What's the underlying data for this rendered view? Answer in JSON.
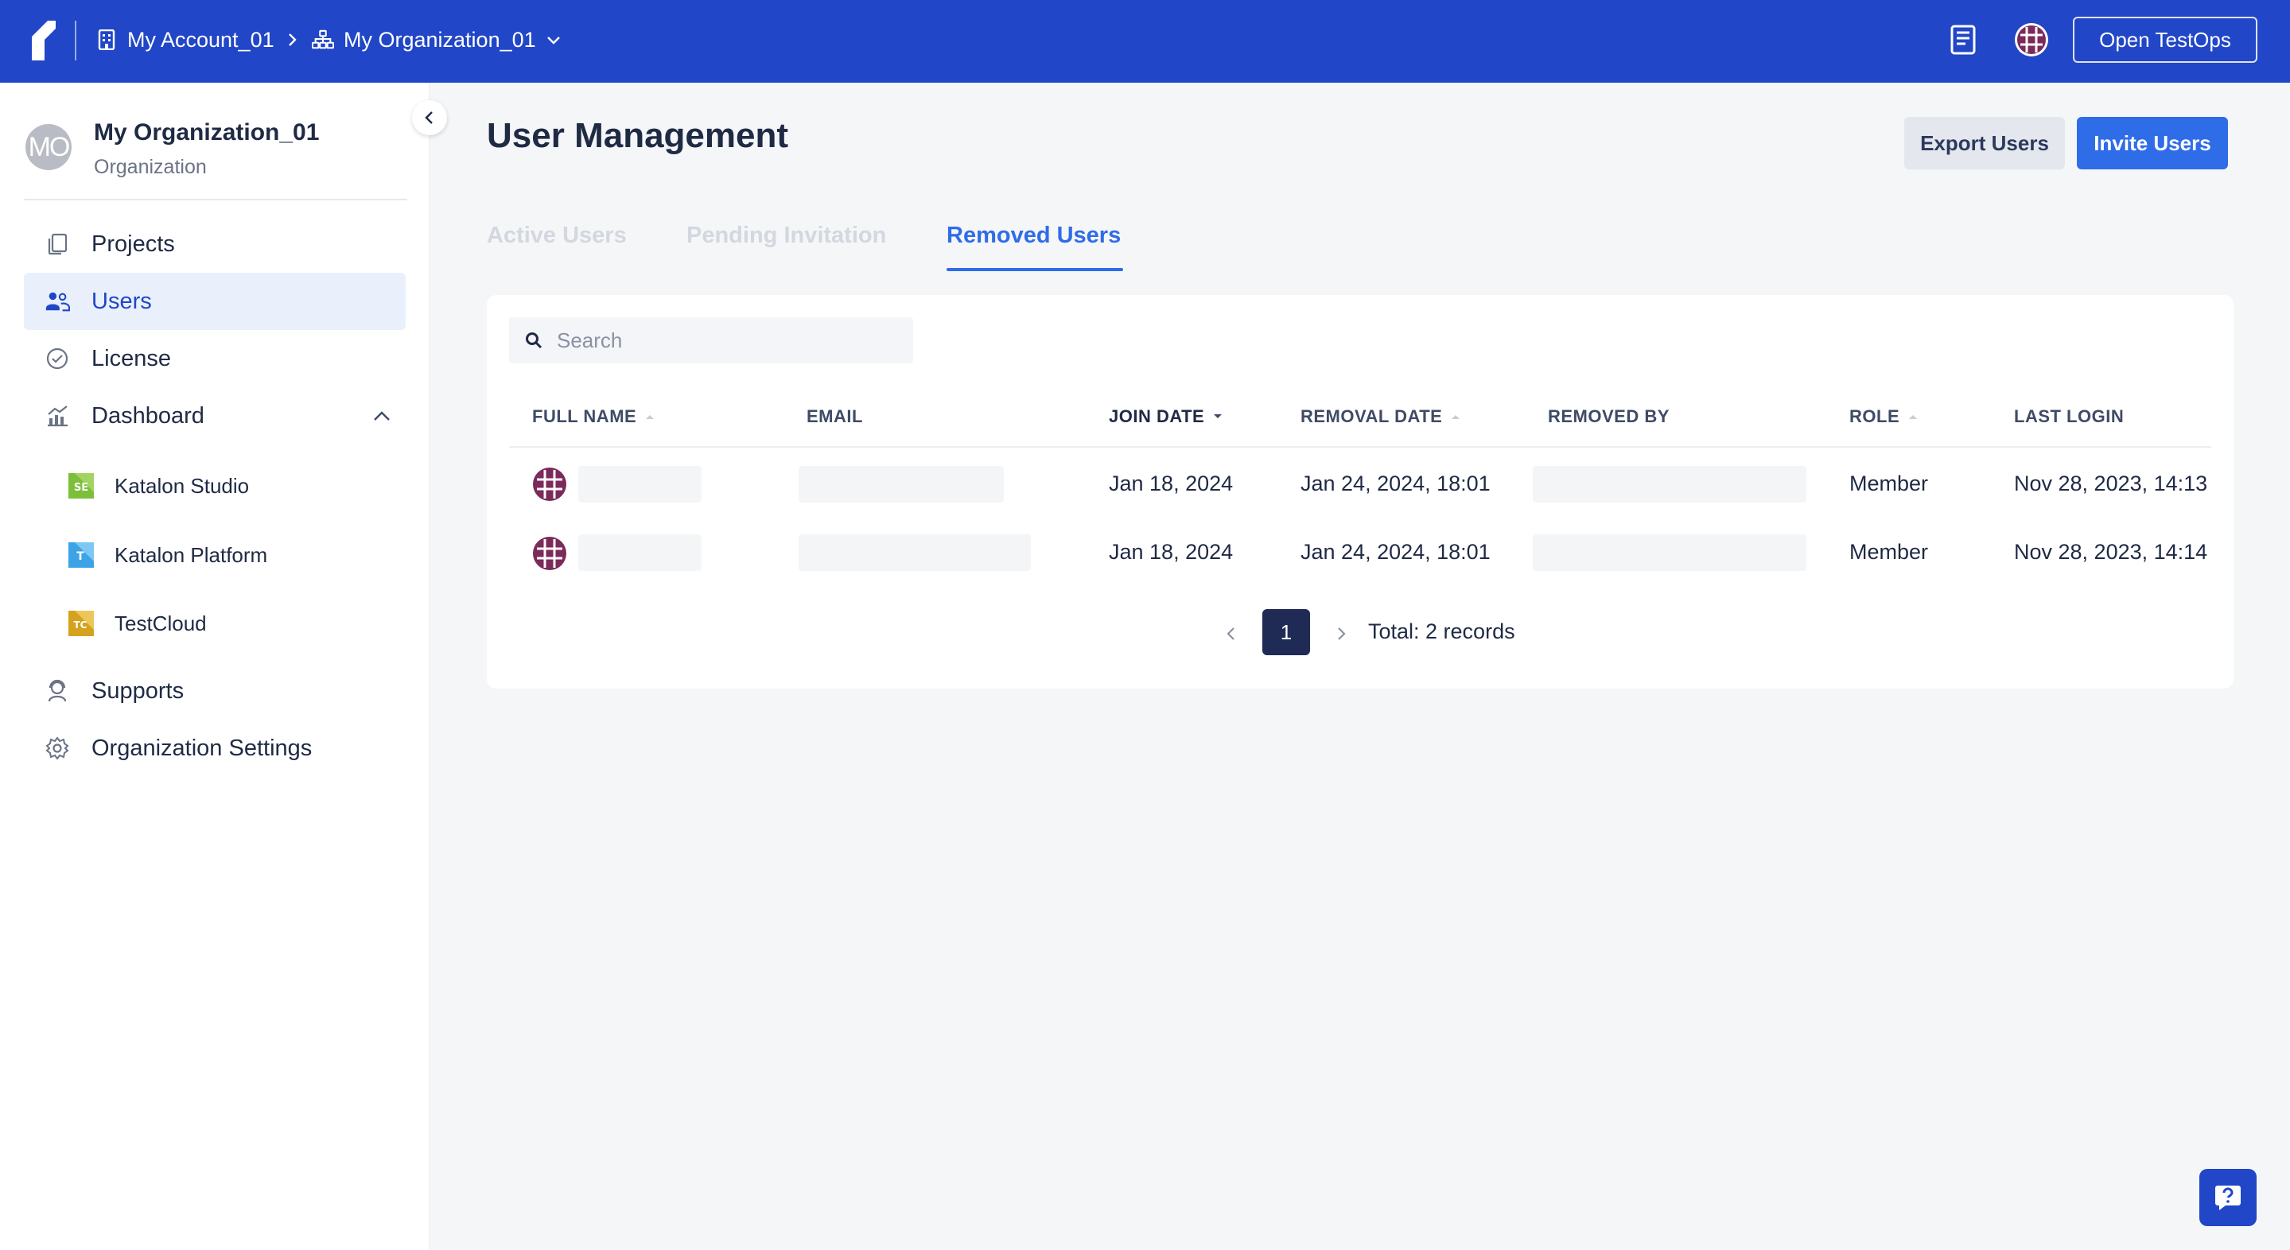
{
  "topbar": {
    "account": "My Account_01",
    "organization": "My Organization_01",
    "open_testops": "Open TestOps",
    "icons": [
      "katalon-logo-icon",
      "building-icon",
      "org-tree-icon",
      "book-icon",
      "user-avatar-icon"
    ]
  },
  "sidebar": {
    "org_initials": "MO",
    "org_name": "My Organization_01",
    "org_type": "Organization",
    "items": [
      {
        "label": "Projects",
        "icon": "projects-icon"
      },
      {
        "label": "Users",
        "icon": "users-icon",
        "active": true
      },
      {
        "label": "License",
        "icon": "license-icon"
      },
      {
        "label": "Dashboard",
        "icon": "dashboard-icon",
        "expanded": true
      },
      {
        "label": "Supports",
        "icon": "supports-icon"
      },
      {
        "label": "Organization Settings",
        "icon": "settings-icon"
      }
    ],
    "dashboard_children": [
      {
        "label": "Katalon Studio",
        "icon": "katalon-studio-icon"
      },
      {
        "label": "Katalon Platform",
        "icon": "katalon-platform-icon"
      },
      {
        "label": "TestCloud",
        "icon": "testcloud-icon"
      }
    ]
  },
  "main": {
    "title": "User Management",
    "export_label": "Export Users",
    "invite_label": "Invite Users",
    "tabs": [
      {
        "label": "Active Users"
      },
      {
        "label": "Pending Invitation"
      },
      {
        "label": "Removed Users",
        "active": true
      }
    ],
    "search_placeholder": "Search",
    "columns": [
      "FULL NAME",
      "EMAIL",
      "JOIN DATE",
      "REMOVAL DATE",
      "REMOVED BY",
      "ROLE",
      "LAST LOGIN"
    ],
    "rows": [
      {
        "join_date": "Jan 18, 2024",
        "removal_date": "Jan 24, 2024, 18:01",
        "role": "Member",
        "last_login": "Nov 28, 2023, 14:13"
      },
      {
        "join_date": "Jan 18, 2024",
        "removal_date": "Jan 24, 2024, 18:01",
        "role": "Member",
        "last_login": "Nov 28, 2023, 14:14"
      }
    ],
    "pagination": {
      "current_page": "1",
      "total": "Total: 2 records"
    }
  },
  "colors": {
    "topbar": "#2146c7",
    "accent": "#2f6ce8",
    "page_active": "#1f2a55",
    "avatar": "#7b2a5a"
  }
}
